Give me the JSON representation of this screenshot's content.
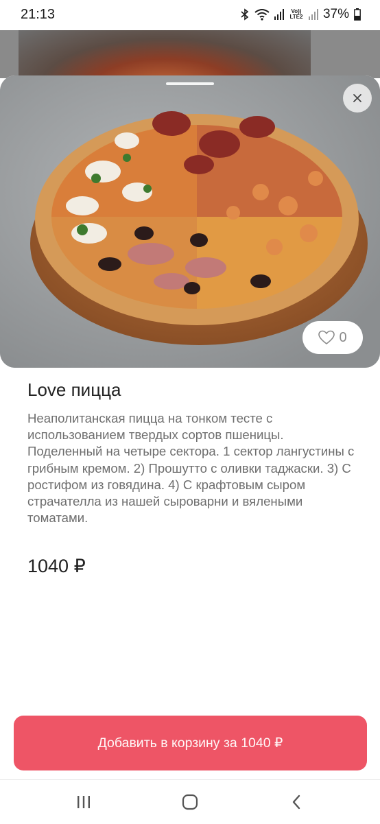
{
  "status_bar": {
    "time": "21:13",
    "battery": "37%",
    "network_label": "Vo)) LTE2",
    "icons": [
      "bluetooth-icon",
      "wifi-icon",
      "signal-icon",
      "signal-icon",
      "battery-icon"
    ]
  },
  "product": {
    "title": "Love пицца",
    "description": "Неаполитанская пицца на тонком тесте с использованием твердых сортов пшеницы. Поделенный на четыре сектора. 1 сектор лангустины с грибным кремом. 2) Прошутто с оливки таджаски. 3) С ростифом из говядина. 4) С крафтовым сыром страчателла из нашей сыроварни и вялеными томатами.",
    "price": "1040 ₽",
    "likes": "0",
    "image_alt": "pizza-photo"
  },
  "cart": {
    "add_label": "Добавить в корзину за 1040 ₽"
  },
  "colors": {
    "accent": "#ee5566",
    "text_primary": "#222222",
    "text_secondary": "#6e6e6e"
  }
}
